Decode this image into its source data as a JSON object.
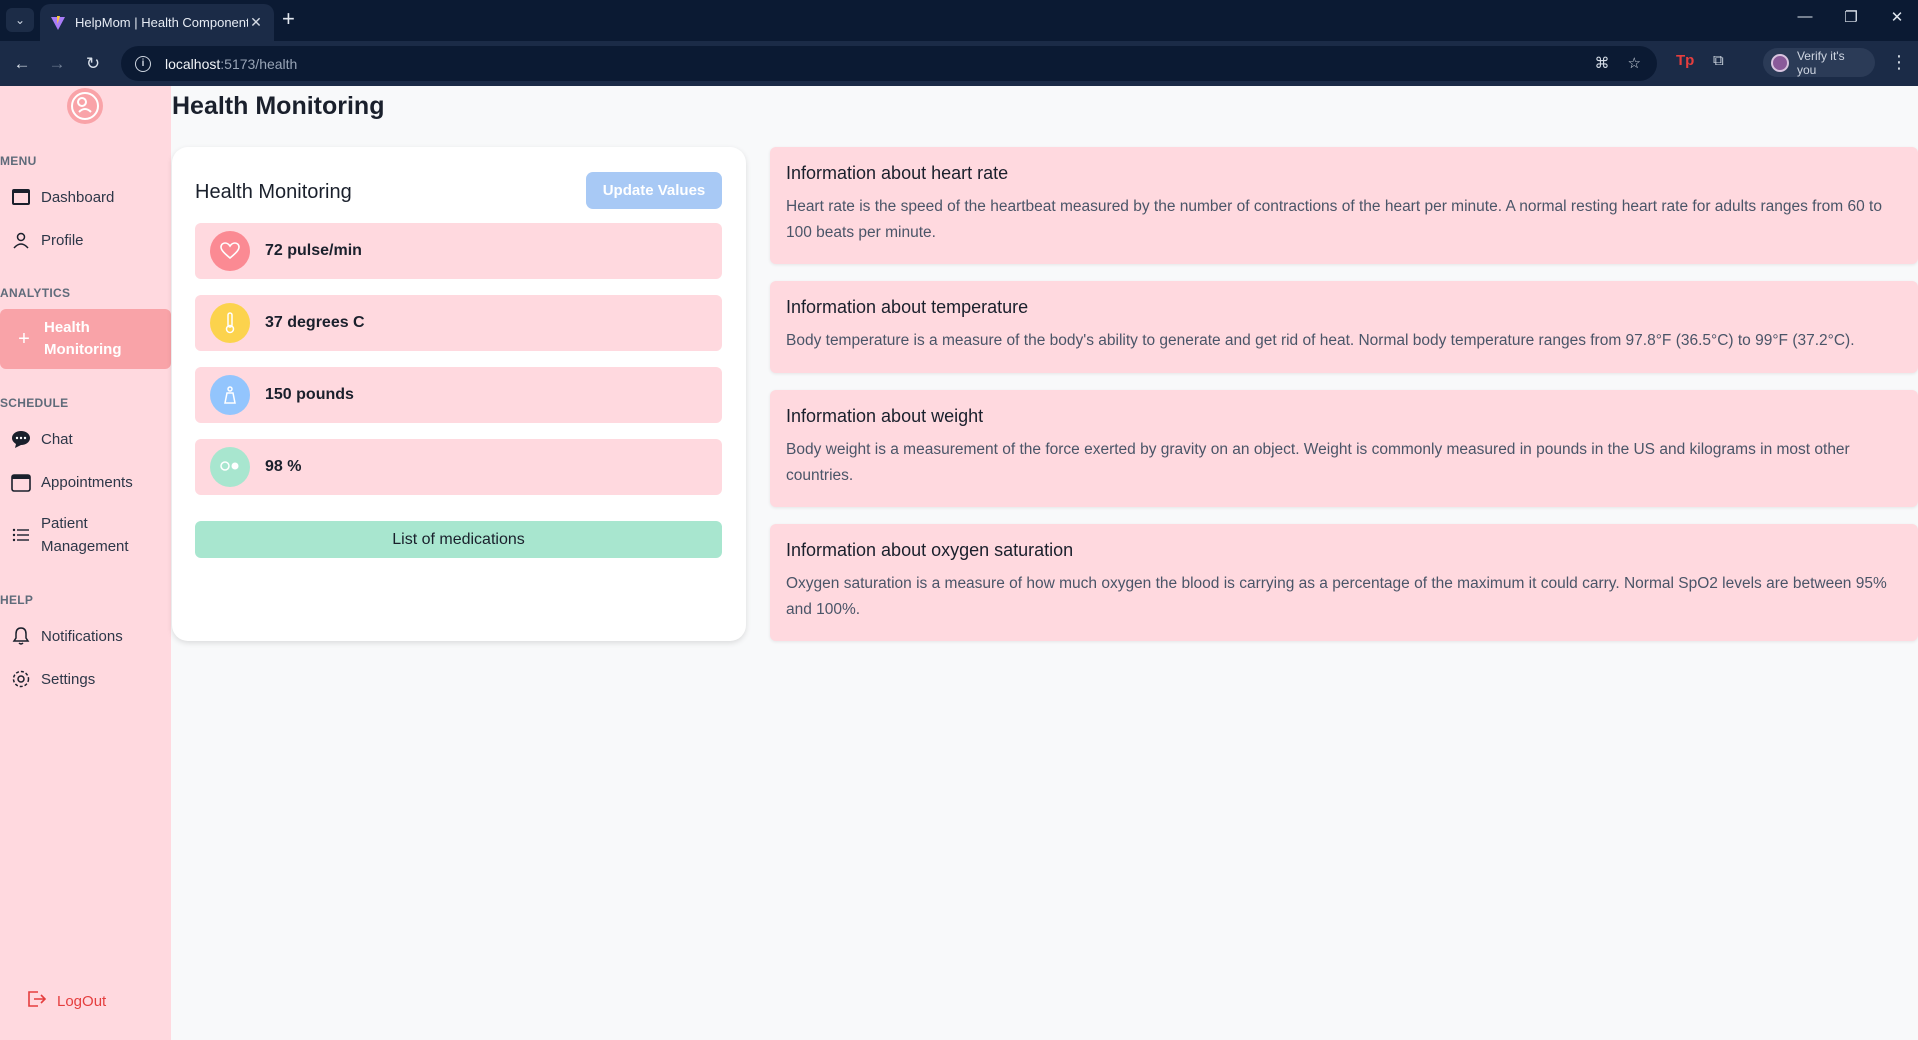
{
  "browser": {
    "tab_title": "HelpMom | Health Component",
    "url_host": "localhost",
    "url_path": ":5173/health",
    "verify_label": "Verify it's you"
  },
  "sidebar": {
    "sections": {
      "menu": "MENU",
      "analytics": "ANALYTICS",
      "schedule": "SCHEDULE",
      "help": "HELP"
    },
    "items": {
      "dashboard": "Dashboard",
      "profile": "Profile",
      "health_line1": "Health",
      "health_line2": "Monitoring",
      "chat": "Chat",
      "appointments": "Appointments",
      "patient_line1": "Patient",
      "patient_line2": "Management",
      "notifications": "Notifications",
      "settings": "Settings"
    },
    "logout": "LogOut"
  },
  "page": {
    "title": "Health Monitoring"
  },
  "monitor": {
    "title": "Health Monitoring",
    "update_button": "Update Values",
    "metrics": [
      {
        "value": "72 pulse/min",
        "icon": "heart-icon",
        "color": "#fb8a93"
      },
      {
        "value": "37 degrees C",
        "icon": "thermometer-icon",
        "color": "#fcd34d"
      },
      {
        "value": "150 pounds",
        "icon": "weight-icon",
        "color": "#93c5fd"
      },
      {
        "value": "98 %",
        "icon": "oxygen-icon",
        "color": "#a8e6cf"
      }
    ],
    "medications_button": "List of medications"
  },
  "info": [
    {
      "title": "Information about heart rate",
      "text": "Heart rate is the speed of the heartbeat measured by the number of contractions of the heart per minute. A normal resting heart rate for adults ranges from 60 to 100 beats per minute."
    },
    {
      "title": "Information about temperature",
      "text": "Body temperature is a measure of the body's ability to generate and get rid of heat. Normal body temperature ranges from 97.8°F (36.5°C) to 99°F (37.2°C)."
    },
    {
      "title": "Information about weight",
      "text": "Body weight is a measurement of the force exerted by gravity on an object. Weight is commonly measured in pounds in the US and kilograms in most other countries."
    },
    {
      "title": "Information about oxygen saturation",
      "text": "Oxygen saturation is a measure of how much oxygen the blood is carrying as a percentage of the maximum it could carry. Normal SpO2 levels are between 95% and 100%."
    }
  ],
  "colors": {
    "sidebar_bg": "#ffd9df",
    "active_item": "#f9a3a8",
    "update_button": "#a8c9f5",
    "medications_button": "#a8e6cf",
    "logout": "#e53e3e"
  }
}
